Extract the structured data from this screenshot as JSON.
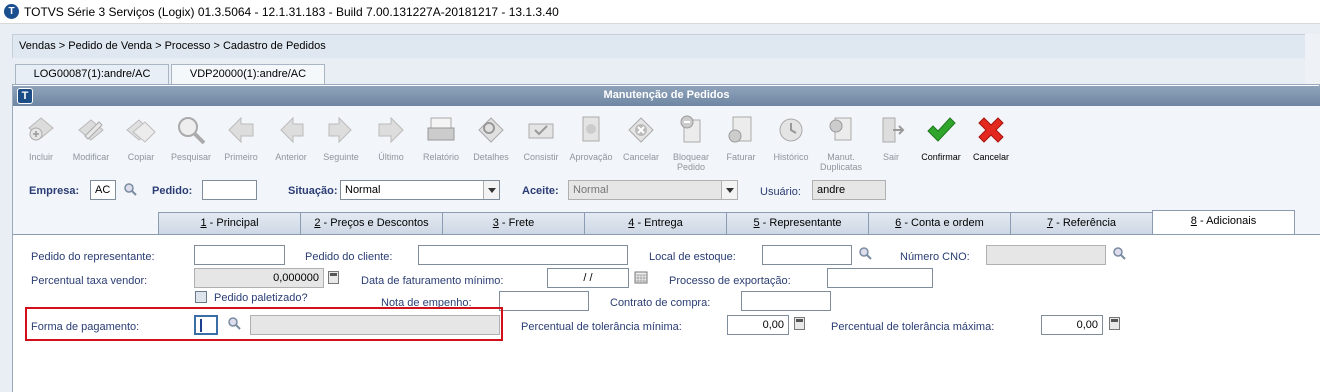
{
  "app": {
    "title": "TOTVS Série 3 Serviços (Logix) 01.3.5064 - 12.1.31.183 - Build 7.00.131227A-20181217 - 13.1.3.40",
    "logo_letter": "T"
  },
  "breadcrumb": "Vendas > Pedido de Venda > Processo > Cadastro de Pedidos",
  "window_tabs": [
    "LOG00087(1):andre/AC",
    "VDP20000(1):andre/AC"
  ],
  "window": {
    "title": "Manutenção de Pedidos"
  },
  "toolbar": [
    {
      "label": "Incluir",
      "icon": "add-icon",
      "enabled": false
    },
    {
      "label": "Modificar",
      "icon": "edit-icon",
      "enabled": false
    },
    {
      "label": "Copiar",
      "icon": "copy-icon",
      "enabled": false
    },
    {
      "label": "Pesquisar",
      "icon": "search-icon",
      "enabled": false
    },
    {
      "label": "Primeiro",
      "icon": "first-icon",
      "enabled": false
    },
    {
      "label": "Anterior",
      "icon": "previous-icon",
      "enabled": false
    },
    {
      "label": "Seguinte",
      "icon": "next-icon",
      "enabled": false
    },
    {
      "label": "Último",
      "icon": "last-icon",
      "enabled": false
    },
    {
      "label": "Relatório",
      "icon": "printer-icon",
      "enabled": false
    },
    {
      "label": "Detalhes",
      "icon": "details-icon",
      "enabled": false
    },
    {
      "label": "Consistir",
      "icon": "validate-icon",
      "enabled": false
    },
    {
      "label": "Aprovação",
      "icon": "approval-icon",
      "enabled": false
    },
    {
      "label": "Cancelar",
      "icon": "cancel-circle-icon",
      "enabled": false
    },
    {
      "label": "Bloquear Pedido",
      "icon": "block-icon",
      "enabled": false
    },
    {
      "label": "Faturar",
      "icon": "invoice-icon",
      "enabled": false
    },
    {
      "label": "Histórico",
      "icon": "history-icon",
      "enabled": false
    },
    {
      "label": "Manut. Duplicatas",
      "icon": "duplicates-icon",
      "enabled": false
    },
    {
      "label": "Sair",
      "icon": "exit-icon",
      "enabled": false
    },
    {
      "label": "Confirmar",
      "icon": "checkmark-icon",
      "enabled": true
    },
    {
      "label": "Cancelar",
      "icon": "close-x-icon",
      "enabled": true
    }
  ],
  "header": {
    "empresa_label": "Empresa:",
    "empresa_value": "AC",
    "pedido_label": "Pedido:",
    "pedido_value": "",
    "situacao_label": "Situação:",
    "situacao_value": "Normal",
    "aceite_label": "Aceite:",
    "aceite_value": "Normal",
    "usuario_label": "Usuário:",
    "usuario_value": "andre"
  },
  "tabs": [
    {
      "num": "1",
      "label": " - Principal"
    },
    {
      "num": "2",
      "label": " - Preços e Descontos"
    },
    {
      "num": "3",
      "label": " - Frete"
    },
    {
      "num": "4",
      "label": " - Entrega"
    },
    {
      "num": "5",
      "label": " - Representante"
    },
    {
      "num": "6",
      "label": " - Conta e ordem"
    },
    {
      "num": "7",
      "label": " - Referência"
    },
    {
      "num": "8",
      "label": " - Adicionais"
    }
  ],
  "active_tab": 8,
  "form": {
    "pedido_representante_label": "Pedido do representante:",
    "pedido_cliente_label": "Pedido do cliente:",
    "local_estoque_label": "Local de estoque:",
    "numero_cno_label": "Número CNO:",
    "percentual_taxa_label": "Percentual taxa vendor:",
    "percentual_taxa_value": "0,000000",
    "data_faturamento_label": "Data de faturamento mínimo:",
    "data_faturamento_value": " / /",
    "processo_exportacao_label": "Processo de exportação:",
    "pedido_paletizado_label": "Pedido paletizado?",
    "nota_empenho_label": "Nota de empenho:",
    "contrato_compra_label": "Contrato de compra:",
    "forma_pagamento_label": "Forma de pagamento:",
    "tolerancia_minima_label": "Percentual de tolerância mínima:",
    "tolerancia_minima_value": "0,00",
    "tolerancia_maxima_label": "Percentual de tolerância máxima:",
    "tolerancia_maxima_value": "0,00"
  },
  "colors": {
    "highlight": "#d0101a",
    "label_blue": "#2a3d74",
    "header_bar": "#7b91ab"
  }
}
